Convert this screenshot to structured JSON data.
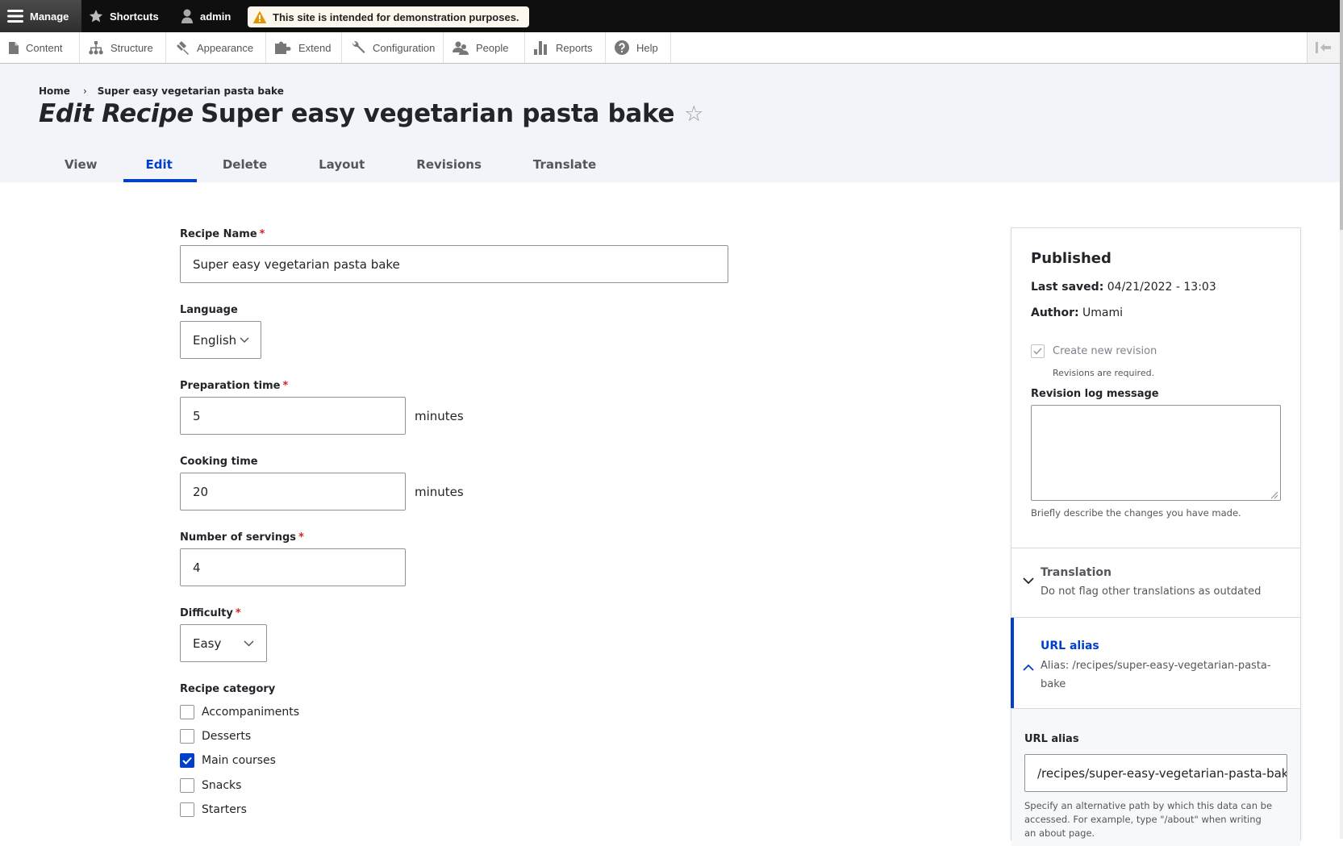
{
  "toolbar": {
    "manage_label": "Manage",
    "shortcuts_label": "Shortcuts",
    "user_label": "admin",
    "demo_notice": "This site is intended for demonstration purposes."
  },
  "tray": {
    "items": [
      {
        "label": "Content",
        "icon": "file-icon"
      },
      {
        "label": "Structure",
        "icon": "sitemap-icon"
      },
      {
        "label": "Appearance",
        "icon": "paintbrush-icon"
      },
      {
        "label": "Extend",
        "icon": "puzzle-icon"
      },
      {
        "label": "Configuration",
        "icon": "wrench-icon"
      },
      {
        "label": "People",
        "icon": "people-icon"
      },
      {
        "label": "Reports",
        "icon": "bar-chart-icon"
      },
      {
        "label": "Help",
        "icon": "help-icon"
      }
    ]
  },
  "breadcrumb": {
    "home": "Home",
    "separator": "›",
    "current": "Super easy vegetarian pasta bake"
  },
  "page": {
    "title_prefix": "Edit Recipe",
    "title": "Super easy vegetarian pasta bake",
    "star": "☆"
  },
  "tabs": [
    {
      "label": "View",
      "active": false
    },
    {
      "label": "Edit",
      "active": true
    },
    {
      "label": "Delete",
      "active": false
    },
    {
      "label": "Layout",
      "active": false
    },
    {
      "label": "Revisions",
      "active": false
    },
    {
      "label": "Translate",
      "active": false
    }
  ],
  "form": {
    "recipe_name": {
      "label": "Recipe Name",
      "required": "*",
      "value": "Super easy vegetarian pasta bake"
    },
    "language": {
      "label": "Language",
      "value": "English"
    },
    "prep_time": {
      "label": "Preparation time",
      "required": "*",
      "value": "5",
      "suffix": "minutes"
    },
    "cooking_time": {
      "label": "Cooking time",
      "value": "20",
      "suffix": "minutes"
    },
    "servings": {
      "label": "Number of servings",
      "required": "*",
      "value": "4"
    },
    "difficulty": {
      "label": "Difficulty",
      "required": "*",
      "value": "Easy"
    },
    "category": {
      "label": "Recipe category",
      "options": [
        {
          "label": "Accompaniments",
          "checked": false
        },
        {
          "label": "Desserts",
          "checked": false
        },
        {
          "label": "Main courses",
          "checked": true
        },
        {
          "label": "Snacks",
          "checked": false
        },
        {
          "label": "Starters",
          "checked": false
        }
      ]
    }
  },
  "sidebar": {
    "status": "Published",
    "last_saved_label": "Last saved:",
    "last_saved_value": "04/21/2022 - 13:03",
    "author_label": "Author:",
    "author_value": "Umami",
    "create_revision_label": "Create new revision",
    "create_revision_checked": true,
    "revisions_required": "Revisions are required.",
    "revision_log_label": "Revision log message",
    "revision_log_value": "",
    "revision_log_desc": "Briefly describe the changes you have made.",
    "translation": {
      "title": "Translation",
      "summary": "Do not flag other translations as outdated"
    },
    "url_alias": {
      "title": "URL alias",
      "summary": "Alias: /recipes/super-easy-vegetarian-pasta-bake",
      "field_label": "URL alias",
      "field_value": "/recipes/super-easy-vegetarian-pasta-bake",
      "field_desc": "Specify an alternative path by which this data can be accessed. For example, type \"/about\" when writing an about page."
    }
  },
  "colors": {
    "accent": "#003ecc",
    "required": "#d72222",
    "toolbar_bg": "#0f0f0f",
    "header_bg": "#f3f4f9"
  }
}
